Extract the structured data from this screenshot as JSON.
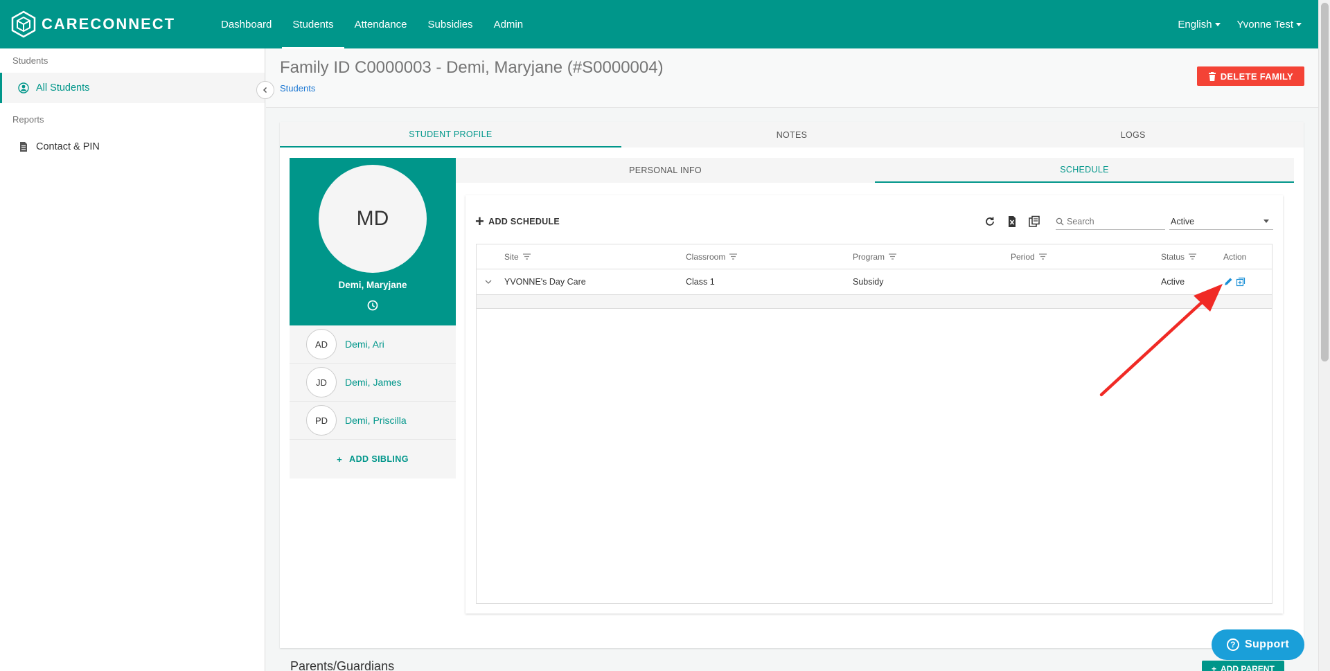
{
  "brand": {
    "name": "CARECONNECT"
  },
  "nav": {
    "items": [
      {
        "label": "Dashboard"
      },
      {
        "label": "Students"
      },
      {
        "label": "Attendance"
      },
      {
        "label": "Subsidies"
      },
      {
        "label": "Admin"
      }
    ],
    "active": "Students",
    "language": "English",
    "user": "Yvonne Test"
  },
  "sidebar": {
    "section_students": "Students",
    "all_students": "All Students",
    "section_reports": "Reports",
    "contact_pin": "Contact & PIN"
  },
  "header": {
    "title": "Family ID C0000003 - Demi, Maryjane (#S0000004)",
    "breadcrumb": "Students",
    "delete_label": "DELETE FAMILY"
  },
  "tabs": {
    "profile": "STUDENT PROFILE",
    "notes": "NOTES",
    "logs": "LOGS"
  },
  "profile": {
    "initials": "MD",
    "name": "Demi, Maryjane"
  },
  "siblings": [
    {
      "initials": "AD",
      "name": "Demi, Ari"
    },
    {
      "initials": "JD",
      "name": "Demi, James"
    },
    {
      "initials": "PD",
      "name": "Demi, Priscilla"
    }
  ],
  "add_sibling": "ADD SIBLING",
  "inner_tabs": {
    "personal": "PERSONAL INFO",
    "schedule": "SCHEDULE"
  },
  "schedule": {
    "add_label": "ADD SCHEDULE",
    "search_placeholder": "Search",
    "status_filter": "Active",
    "columns": {
      "site": "Site",
      "classroom": "Classroom",
      "program": "Program",
      "period": "Period",
      "status": "Status",
      "action": "Action"
    },
    "rows": [
      {
        "site": "YVONNE's Day Care",
        "classroom": "Class 1",
        "program": "Subsidy",
        "period": "",
        "status": "Active"
      }
    ]
  },
  "parents": {
    "title": "Parents/Guardians",
    "add_label": "ADD PARENT"
  },
  "support": {
    "label": "Support"
  },
  "colors": {
    "primary": "#00968a",
    "danger": "#f44336",
    "support": "#1a9fd9",
    "annotation": "#f02a25"
  }
}
